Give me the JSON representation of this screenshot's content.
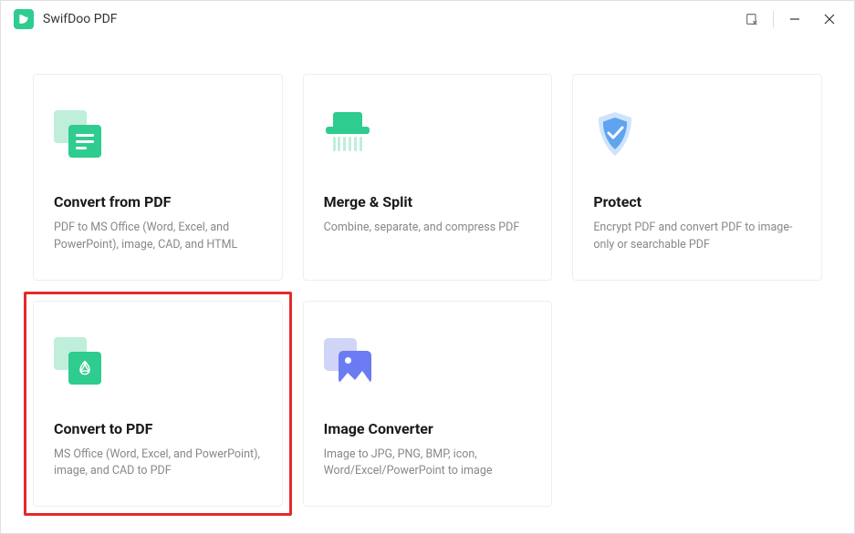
{
  "app": {
    "title": "SwifDoo PDF"
  },
  "cards": {
    "convert_from": {
      "title": "Convert from PDF",
      "desc": "PDF to MS Office (Word, Excel, and PowerPoint), image, CAD, and HTML"
    },
    "merge_split": {
      "title": "Merge & Split",
      "desc": "Combine, separate, and compress PDF"
    },
    "protect": {
      "title": "Protect",
      "desc": "Encrypt PDF and convert PDF to image-only or searchable PDF"
    },
    "convert_to": {
      "title": "Convert to PDF",
      "desc": "MS Office (Word, Excel, and PowerPoint), image, and CAD to PDF"
    },
    "image_converter": {
      "title": "Image Converter",
      "desc": "Image to JPG, PNG, BMP, icon, Word/Excel/PowerPoint to image"
    }
  }
}
